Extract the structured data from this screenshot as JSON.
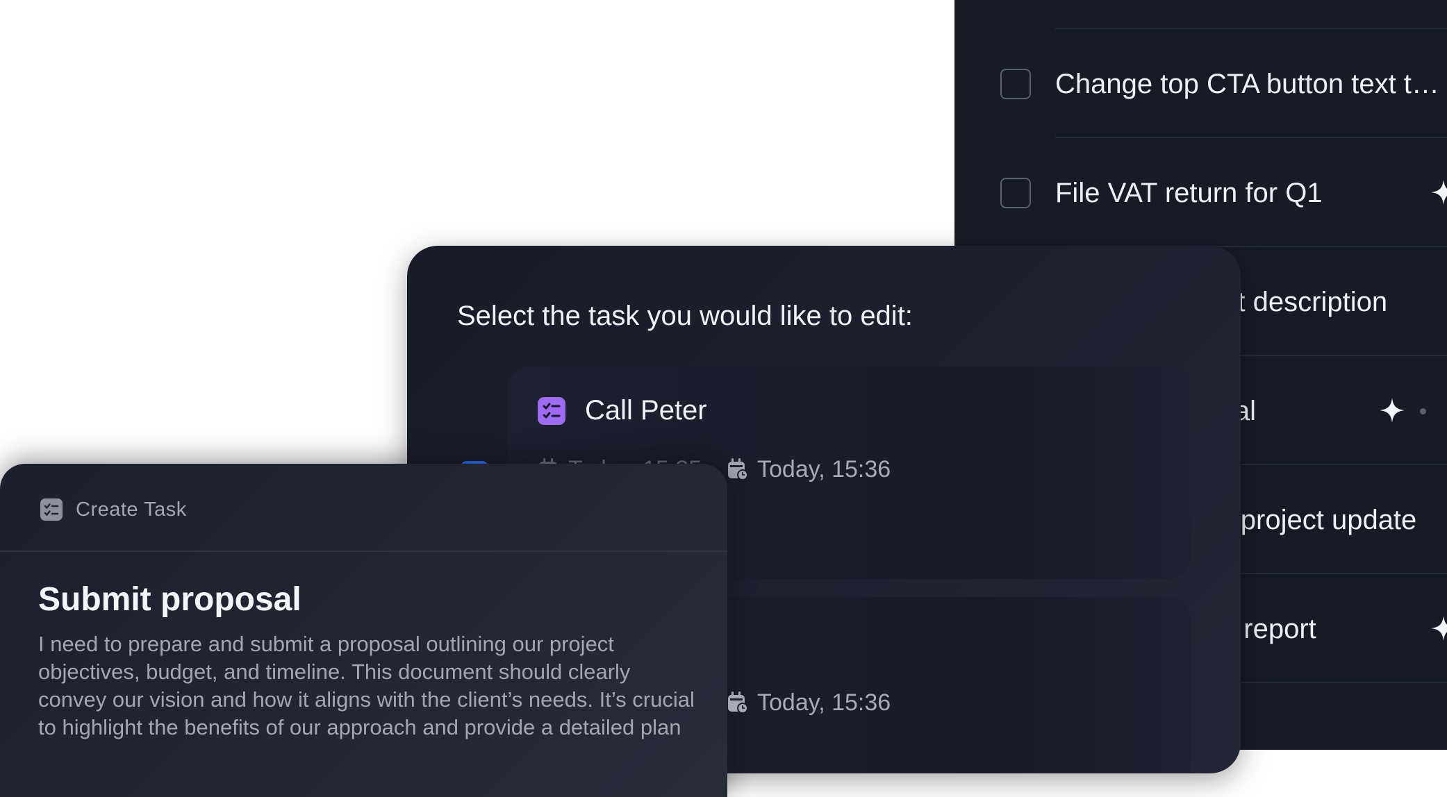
{
  "task_list": {
    "rows": [
      {
        "title": "",
        "has_checkbox": false
      },
      {
        "title": "Change top CTA button text to the new copy",
        "has_checkbox": true
      },
      {
        "title": "File VAT return for Q1",
        "has_checkbox": true
      },
      {
        "title": "Update product description",
        "has_checkbox": true
      },
      {
        "title": "Submit proposal",
        "has_checkbox": true
      },
      {
        "title": "Email team on project update",
        "has_checkbox": true
      },
      {
        "title": "Send quarterly report",
        "has_checkbox": true
      }
    ]
  },
  "select_panel": {
    "prompt": "Select the task you would like to edit:",
    "first_card": {
      "title": "Call Peter",
      "meta_left": "Today, 15:35",
      "meta_right": "Today,  15:36"
    },
    "second_card": {
      "meta_right": "Today,  15:36"
    }
  },
  "create_panel": {
    "header_label": "Create Task",
    "title": "Submit proposal",
    "body": "I need to prepare and submit a proposal outlining our project objectives, budget, and timeline. This document should clearly convey our vision and how it aligns with the client’s needs. It’s crucial to highlight the benefits of our approach and provide a detailed plan"
  },
  "colors": {
    "panel_bg": "#171b26",
    "accent_purple": "#9d6cf2",
    "accent_blue": "#2c6df2",
    "text_primary": "#eef0f5",
    "text_secondary": "#a7abb6"
  },
  "icons": {
    "checkbox": "checkbox-icon",
    "sparkle": "sparkle-icon",
    "task": "task-list-icon",
    "calendar": "calendar-clock-icon"
  }
}
